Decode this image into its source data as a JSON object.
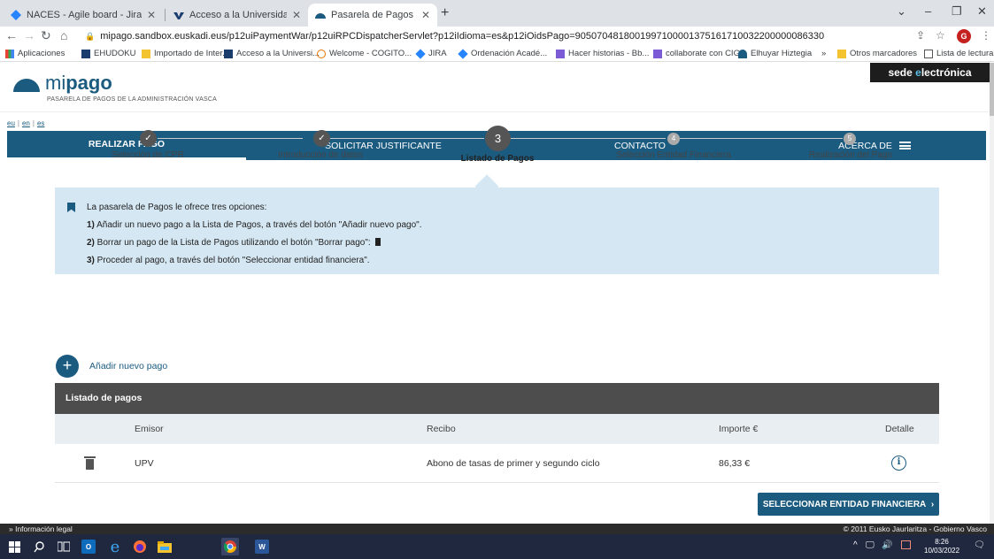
{
  "browser": {
    "tabs": [
      {
        "title": "NACES - Agile board - Jira",
        "active": false
      },
      {
        "title": "Acceso a la Universidad - UPV/EH",
        "active": false
      },
      {
        "title": "Pasarela de Pagos de la Adminis",
        "active": true
      }
    ],
    "url": "mipago.sandbox.euskadi.eus/p12uiPaymentWar/p12uiRPCDispatcherServlet?p12iIdioma=es&p12iOidsPago=9050704818001997100001375161710032200000086330",
    "profile_initial": "G",
    "bookmarks": [
      "Aplicaciones",
      "EHUDOKU",
      "Importado de Inter...",
      "Acceso a la Universi...",
      "Welcome - COGITO...",
      "JIRA",
      "Ordenación Acadé...",
      "Hacer historias - Bb...",
      "collaborate con CIG",
      "Elhuyar Hiztegia",
      "»",
      "Otros marcadores",
      "Lista de lectura"
    ]
  },
  "header": {
    "logo_light": "mi",
    "logo_bold": "pago",
    "logo_subtitle": "PASARELA DE PAGOS DE LA ADMINISTRACIÓN VASCA",
    "sede_prefix": "sede ",
    "sede_e": "e",
    "sede_suffix": "lectrónica",
    "languages": [
      "eu",
      "en",
      "es"
    ]
  },
  "nav": {
    "items": [
      "REALIZAR PAGO",
      "SOLICITAR JUSTIFICANTE",
      "CONTACTO",
      "ACERCA DE"
    ]
  },
  "steps": [
    {
      "num": "",
      "label": "Selección de CPR",
      "state": "done"
    },
    {
      "num": "",
      "label": "Introducción de datos",
      "state": "done"
    },
    {
      "num": "3",
      "label": "Listado de Pagos",
      "state": "current"
    },
    {
      "num": "4",
      "label": "Selección Entidad Financiera",
      "state": "future"
    },
    {
      "num": "5",
      "label": "Realización del Pago",
      "state": "future"
    }
  ],
  "info": {
    "intro": "La pasarela de Pagos le ofrece tres opciones:",
    "opt1_num": "1)",
    "opt1_text": " Añadir un nuevo pago a la Lista de Pagos, a través del botón \"Añadir nuevo pago\".",
    "opt2_num": "2)",
    "opt2_text": " Borrar un pago de la Lista de Pagos utilizando el botón \"Borrar pago\": ",
    "opt3_num": "3)",
    "opt3_text": " Proceder al pago, a través del botón \"Seleccionar entidad financiera\"."
  },
  "add_payment_label": "Añadir nuevo pago",
  "table": {
    "title": "Listado de pagos",
    "columns": [
      "Emisor",
      "Recibo",
      "Importe €",
      "Detalle"
    ],
    "rows": [
      {
        "emisor": "UPV",
        "recibo": "Abono de tasas de primer y segundo ciclo",
        "importe": "86,33 €"
      }
    ]
  },
  "select_button_label": "SELECCIONAR ENTIDAD FINANCIERA",
  "footer": {
    "left": "» Información legal",
    "right": "© 2011 Eusko Jaurlaritza - Gobierno Vasco"
  },
  "taskbar": {
    "time": "8:26",
    "date": "10/03/2022"
  }
}
